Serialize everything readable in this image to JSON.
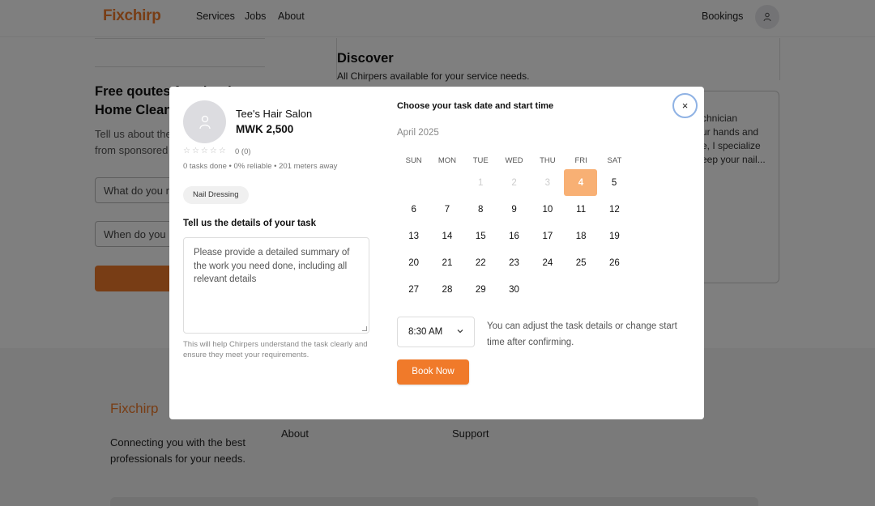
{
  "header": {
    "logo": "Fixchirp",
    "nav": [
      "Services",
      "Jobs",
      "About"
    ],
    "bookings": "Bookings",
    "avatar_icon": "user-icon"
  },
  "left_panel": {
    "title": "Free qoutes for cloud\nHome Clean",
    "text": "Tell us about the\nfrom sponsored",
    "input_1": "What do you need",
    "input_2": "When do you need"
  },
  "discover": {
    "title": "Discover",
    "subtitle": "All Chirpers available for your service needs."
  },
  "bg_card": {
    "text": "chnician\nur hands and\ne, I specialize\neep your nail..."
  },
  "footer": {
    "logo": "Fixchirp",
    "tagline": "Connecting you with the best professionals for your needs.",
    "links": [
      "About",
      "Support"
    ]
  },
  "modal": {
    "provider_name": "Tee's Hair Salon",
    "price": "MWK 2,500",
    "stars": "☆☆☆☆☆",
    "rating": "0 (0)",
    "meta": "0 tasks done • 0% reliable • 201 meters away",
    "tag": "Nail Dressing",
    "details_label": "Tell us the details of your task",
    "details_placeholder": "Please provide a detailed summary of the work you need done, including all relevant details",
    "help_text": "This will help Chirpers understand the task clearly and ensure they meet your requirements.",
    "choose_label": "Choose your task date and start time",
    "month": "April 2025",
    "weekdays": [
      "SUN",
      "MON",
      "TUE",
      "WED",
      "THU",
      "FRI",
      "SAT"
    ],
    "calendar_rows": [
      [
        "",
        "",
        "1",
        "2",
        "3",
        "4",
        "5"
      ],
      [
        "6",
        "7",
        "8",
        "9",
        "10",
        "11",
        "12"
      ],
      [
        "13",
        "14",
        "15",
        "16",
        "17",
        "18",
        "19"
      ],
      [
        "20",
        "21",
        "22",
        "23",
        "24",
        "25",
        "26"
      ],
      [
        "27",
        "28",
        "29",
        "30",
        "",
        "",
        ""
      ]
    ],
    "disabled_days": [
      "1",
      "2",
      "3"
    ],
    "selected_day": "4",
    "time_value": "8:30 AM",
    "adjust_text": "You can adjust the task details or change start time after confirming.",
    "book_button": "Book Now",
    "close_icon": "×"
  },
  "colors": {
    "brand": "#f07a2a",
    "selected_day": "#f8b074",
    "close_ring": "#8fb2e4"
  }
}
